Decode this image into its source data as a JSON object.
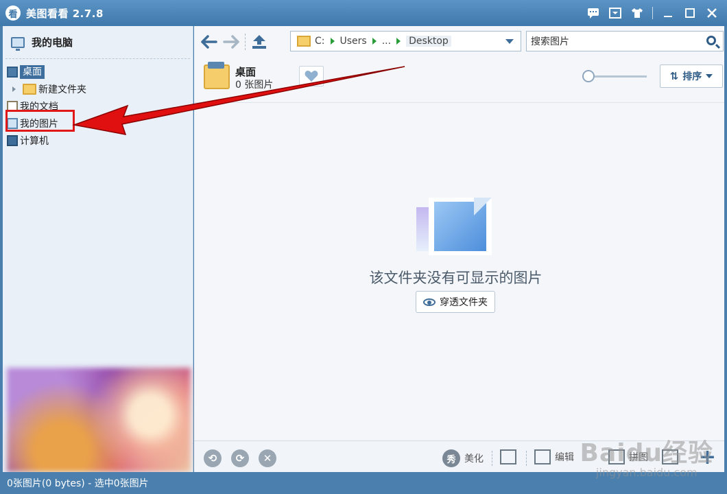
{
  "app": {
    "logo_char": "看",
    "title": "美图看看 2.7.8"
  },
  "window_controls": [
    "chat-icon",
    "menu-icon",
    "skin-icon",
    "minimize-icon",
    "maximize-icon",
    "close-icon"
  ],
  "sidebar": {
    "header": "我的电脑",
    "items": [
      {
        "label": "桌面",
        "icon": "desktop-icon",
        "selected": true
      },
      {
        "label": "新建文件夹",
        "icon": "folder-icon",
        "child": true
      },
      {
        "label": "我的文档",
        "icon": "documents-icon"
      },
      {
        "label": "我的图片",
        "icon": "pictures-icon",
        "highlighted": true
      },
      {
        "label": "计算机",
        "icon": "computer-icon"
      }
    ]
  },
  "toolbar": {
    "address": {
      "crumbs": [
        "C:",
        "Users",
        "...",
        "Desktop"
      ]
    },
    "search": {
      "placeholder": "搜索图片"
    }
  },
  "folder_info": {
    "name": "桌面",
    "count": "0 张图片"
  },
  "sort": {
    "label": "排序"
  },
  "empty_state": {
    "message": "该文件夹没有可显示的图片",
    "button": "穿透文件夹"
  },
  "bottombar": {
    "beautify_badge": "秀",
    "beautify": "美化",
    "edit": "编辑",
    "collage": "拼图"
  },
  "statusbar": {
    "text": "0张图片(0 bytes) - 选中0张图片"
  },
  "watermark": {
    "main": "Baidu经验",
    "sub": "jingyan.baidu.com"
  },
  "colors": {
    "accent": "#4a7fae",
    "highlight_red": "#e01818"
  }
}
